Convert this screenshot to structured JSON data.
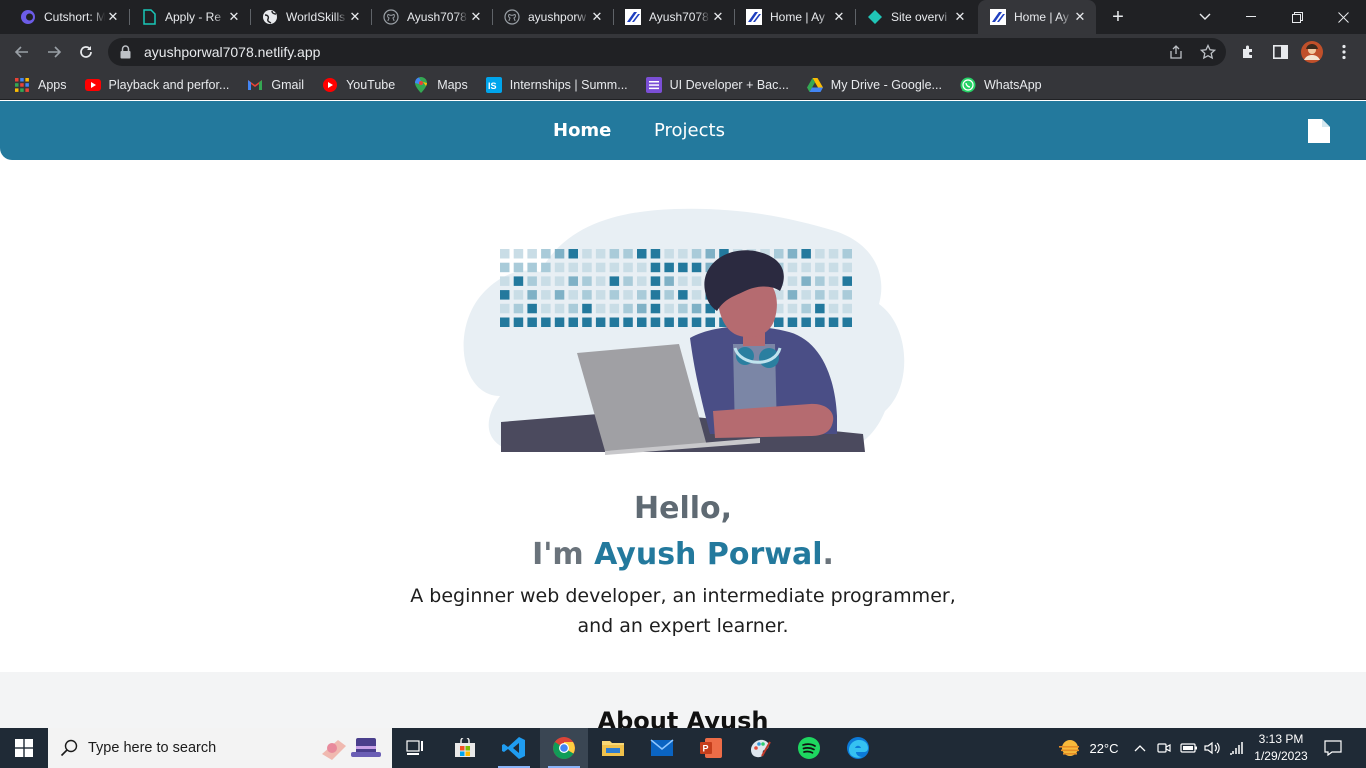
{
  "browser": {
    "tabs": [
      {
        "title": "Cutshort: M",
        "icon": "cutshort-icon",
        "active": false
      },
      {
        "title": "Apply - Re",
        "icon": "doc-icon",
        "active": false
      },
      {
        "title": "WorldSkills",
        "icon": "globe-icon",
        "active": false
      },
      {
        "title": "Ayush7078",
        "icon": "github-icon",
        "active": false
      },
      {
        "title": "ayushporw",
        "icon": "github-icon",
        "active": false
      },
      {
        "title": "Ayush7078",
        "icon": "site-icon",
        "active": false
      },
      {
        "title": "Home | Ay",
        "icon": "site-icon",
        "active": false
      },
      {
        "title": "Site overvi",
        "icon": "netlify-icon",
        "active": false
      },
      {
        "title": "Home | Ay",
        "icon": "site-icon",
        "active": true
      }
    ],
    "url": "ayushporwal7078.netlify.app",
    "bookmarks": [
      {
        "label": "Apps",
        "icon": "apps-grid-icon"
      },
      {
        "label": "Playback and perfor...",
        "icon": "youtube-studio-icon"
      },
      {
        "label": "Gmail",
        "icon": "gmail-icon"
      },
      {
        "label": "YouTube",
        "icon": "youtube-icon"
      },
      {
        "label": "Maps",
        "icon": "maps-icon"
      },
      {
        "label": "Internships | Summ...",
        "icon": "internshala-icon"
      },
      {
        "label": "UI Developer + Bac...",
        "icon": "list-icon"
      },
      {
        "label": "My Drive - Google...",
        "icon": "drive-icon"
      },
      {
        "label": "WhatsApp",
        "icon": "whatsapp-icon"
      }
    ]
  },
  "site": {
    "nav": {
      "home": "Home",
      "projects": "Projects"
    },
    "hero": {
      "hello": "Hello,",
      "im": "I'm ",
      "name": "Ayush Porwal",
      "period": ".",
      "tagline_line1": "A beginner web developer, an intermediate programmer,",
      "tagline_line2": "and an expert learner."
    },
    "about_title": "About Ayush",
    "colors": {
      "brand": "#23799d",
      "heading_gray": "#5f6a73"
    }
  },
  "taskbar": {
    "search_placeholder": "Type here to search",
    "weather": "22°C",
    "time": "3:13 PM",
    "date": "1/29/2023",
    "apps": [
      "task-view-icon",
      "store-icon",
      "vscode-icon",
      "chrome-icon",
      "file-explorer-icon",
      "mail-icon",
      "powerpoint-icon",
      "paint-icon",
      "spotify-icon",
      "edge-icon"
    ]
  }
}
